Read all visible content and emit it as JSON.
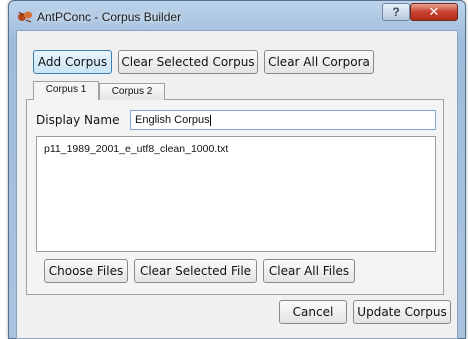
{
  "window": {
    "title": "AntPConc - Corpus Builder",
    "help_label": "?",
    "close_label": "✕"
  },
  "toolbar": {
    "add_corpus": "Add Corpus",
    "clear_selected_corpus": "Clear Selected Corpus",
    "clear_all_corpora": "Clear All Corpora"
  },
  "tabs": [
    {
      "label": "Corpus 1",
      "active": true
    },
    {
      "label": "Corpus 2",
      "active": false
    }
  ],
  "corpus": {
    "display_name_label": "Display Name",
    "display_name_value": "English Corpus",
    "files": [
      "p11_1989_2001_e_utf8_clean_1000.txt"
    ]
  },
  "file_buttons": {
    "choose_files": "Choose Files",
    "clear_selected_file": "Clear Selected File",
    "clear_all_files": "Clear All Files"
  },
  "footer": {
    "cancel": "Cancel",
    "update_corpus": "Update Corpus"
  }
}
